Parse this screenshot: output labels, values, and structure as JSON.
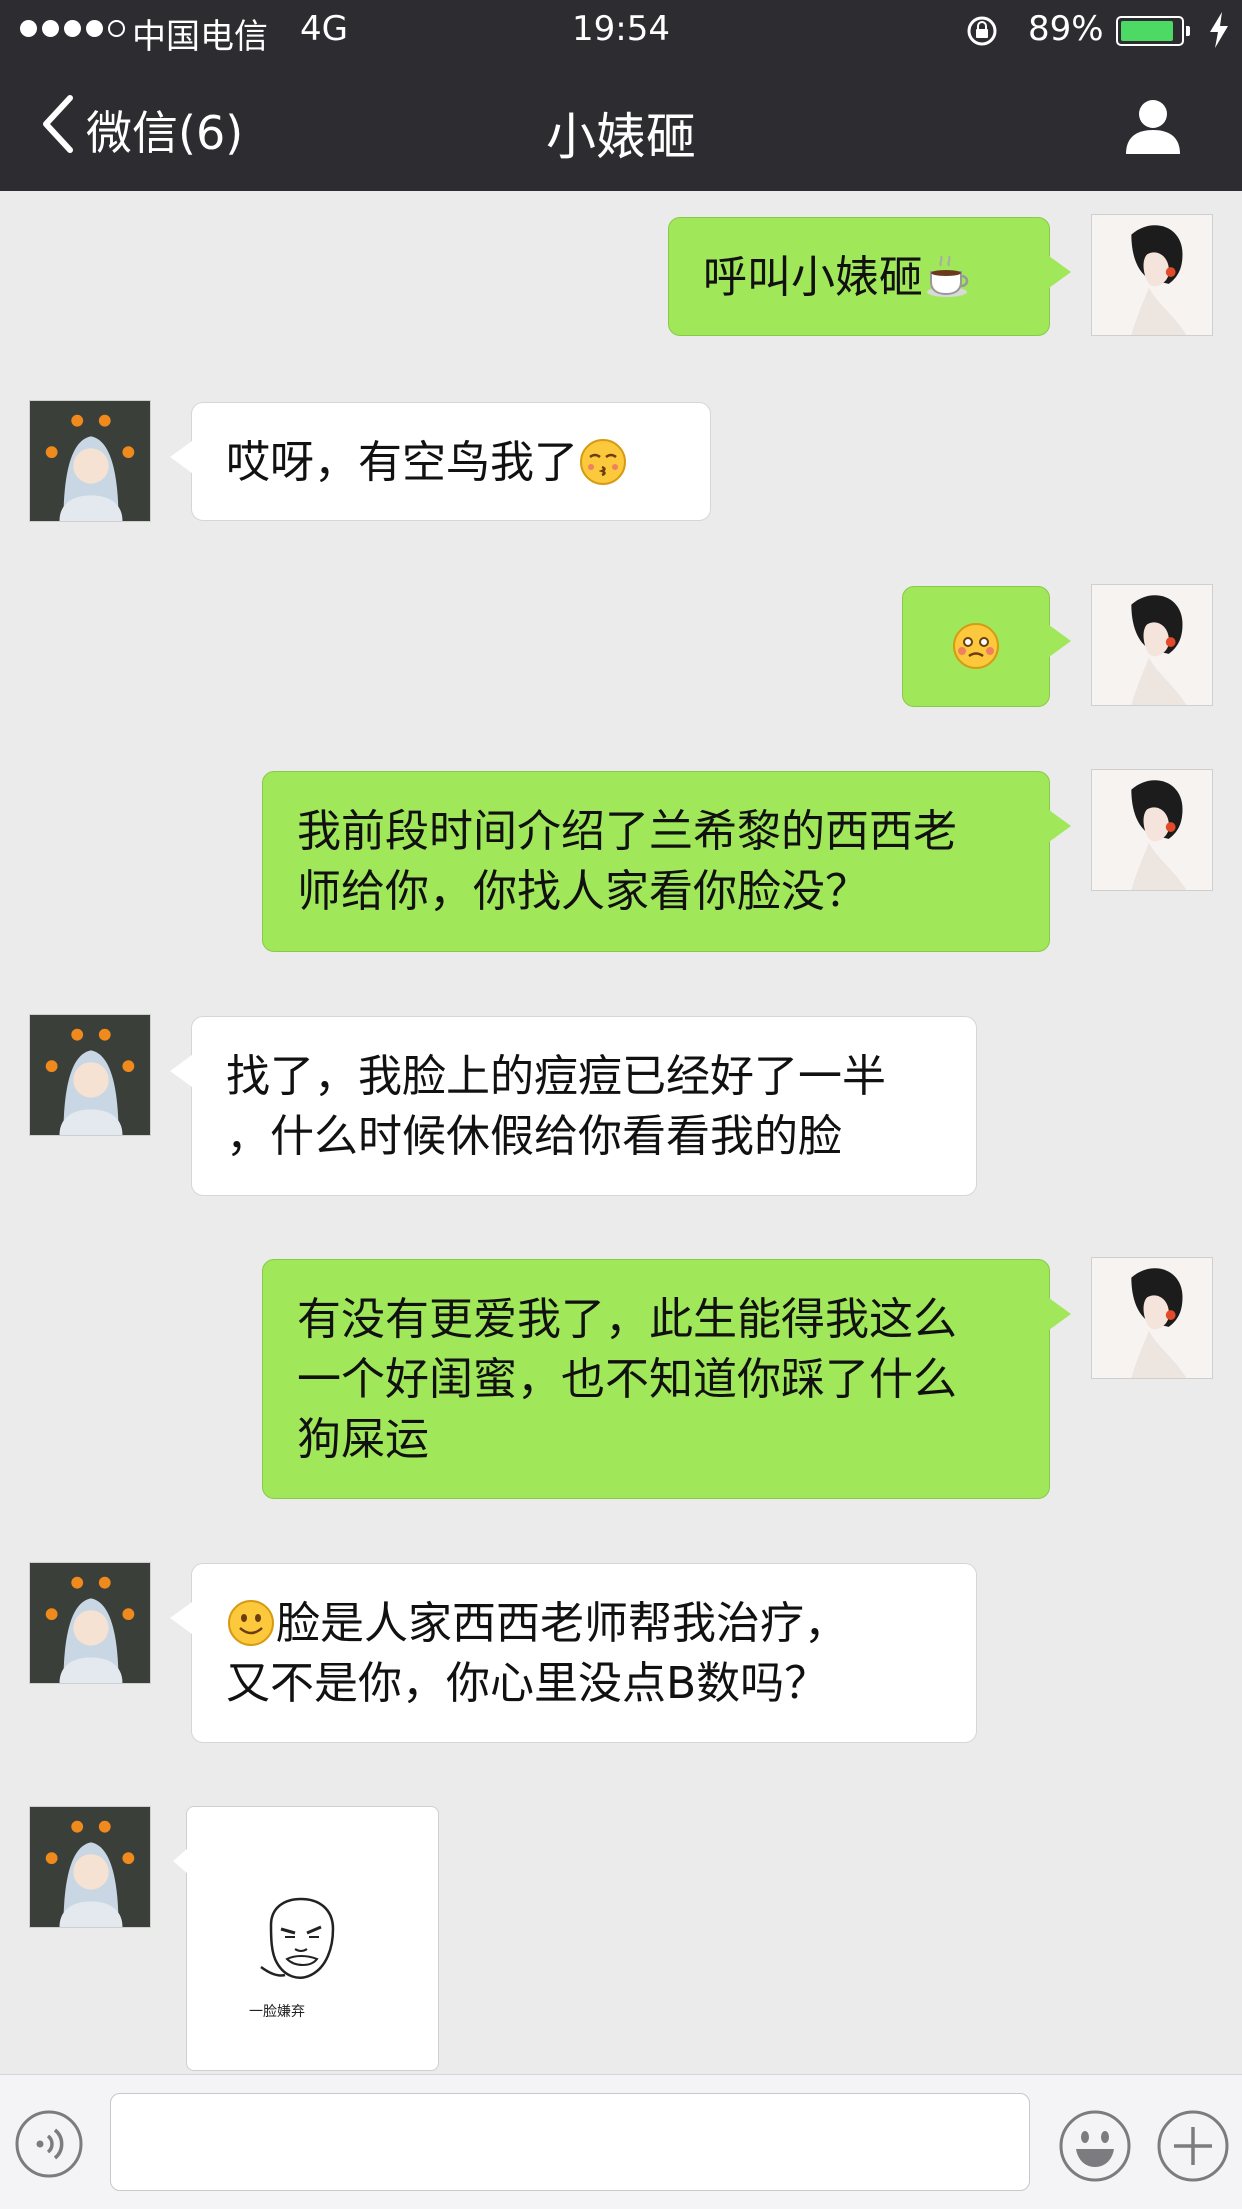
{
  "status_bar": {
    "carrier": "中国电信",
    "network": "4G",
    "time": "19:54",
    "battery_percent": "89%",
    "battery_level": 0.89
  },
  "nav": {
    "back_label": "微信(6)",
    "title": "小婊砸"
  },
  "messages": [
    {
      "sender": "me",
      "lines": [
        "呼叫小婊砸"
      ],
      "trailing_emoji": "coffee"
    },
    {
      "sender": "them",
      "lines": [
        "哎呀，有空鸟我了"
      ],
      "trailing_emoji": "kissing-face"
    },
    {
      "sender": "me",
      "lines": [
        ""
      ],
      "trailing_emoji": "flushed-face"
    },
    {
      "sender": "me",
      "lines": [
        "我前段时间介绍了兰希黎的西西老",
        "师给你，你找人家看你脸没？"
      ]
    },
    {
      "sender": "them",
      "lines": [
        "找了，我脸上的痘痘已经好了一半",
        "，什么时候休假给你看看我的脸"
      ]
    },
    {
      "sender": "me",
      "lines": [
        "有没有更爱我了，此生能得我这么",
        "一个好闺蜜，也不知道你踩了什么",
        "狗屎运"
      ]
    },
    {
      "sender": "them",
      "lines": [
        "脸是人家西西老师帮我治疗，",
        "又不是你，你心里没点B数吗？"
      ],
      "leading_emoji": "smiling-face"
    },
    {
      "sender": "them",
      "type": "sticker",
      "caption": "一脸嫌弃"
    }
  ],
  "input_bar": {
    "voice_icon": "voice-icon",
    "emoji_icon": "emoji-icon",
    "plus_icon": "plus-icon"
  }
}
